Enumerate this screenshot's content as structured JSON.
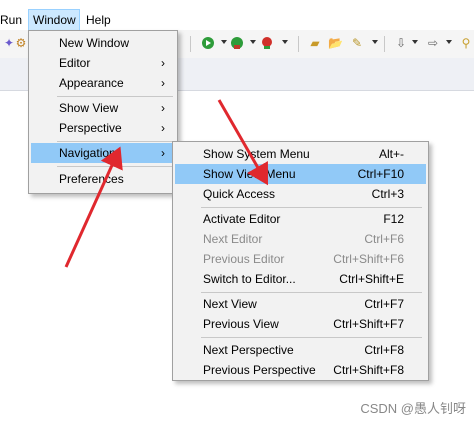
{
  "menubar": {
    "run": "Run",
    "window": "Window",
    "help": "Help"
  },
  "toolbar_icons": [
    "debug-icon",
    "run-icon",
    "external-tools-icon",
    "new-java-project-icon",
    "open-type-icon",
    "search-icon",
    "pin-icon",
    "back-icon",
    "forward-icon"
  ],
  "window_menu": {
    "items": [
      {
        "label": "New Window",
        "submenu": false
      },
      {
        "label": "Editor",
        "submenu": true
      },
      {
        "label": "Appearance",
        "submenu": true
      },
      {
        "label": "Show View",
        "submenu": true
      },
      {
        "label": "Perspective",
        "submenu": true
      },
      {
        "label": "Navigation",
        "submenu": true,
        "highlighted": true
      },
      {
        "label": "Preferences",
        "submenu": false
      }
    ]
  },
  "navigation_menu": {
    "items": [
      {
        "label": "Show System Menu",
        "accel": "Alt+-",
        "enabled": true
      },
      {
        "label": "Show View Menu",
        "accel": "Ctrl+F10",
        "enabled": true,
        "highlighted": true
      },
      {
        "label": "Quick Access",
        "accel": "Ctrl+3",
        "enabled": true
      },
      {
        "label": "Activate Editor",
        "accel": "F12",
        "enabled": true
      },
      {
        "label": "Next Editor",
        "accel": "Ctrl+F6",
        "enabled": false
      },
      {
        "label": "Previous Editor",
        "accel": "Ctrl+Shift+F6",
        "enabled": false
      },
      {
        "label": "Switch to Editor...",
        "accel": "Ctrl+Shift+E",
        "enabled": true
      },
      {
        "label": "Next View",
        "accel": "Ctrl+F7",
        "enabled": true
      },
      {
        "label": "Previous View",
        "accel": "Ctrl+Shift+F7",
        "enabled": true
      },
      {
        "label": "Next Perspective",
        "accel": "Ctrl+F8",
        "enabled": true
      },
      {
        "label": "Previous Perspective",
        "accel": "Ctrl+Shift+F8",
        "enabled": true
      }
    ]
  },
  "watermark": "CSDN @愚人钊呀",
  "colors": {
    "highlight": "#91c9f7",
    "menubar_active": "#cce8ff",
    "annotation_arrow": "#e0282e"
  }
}
